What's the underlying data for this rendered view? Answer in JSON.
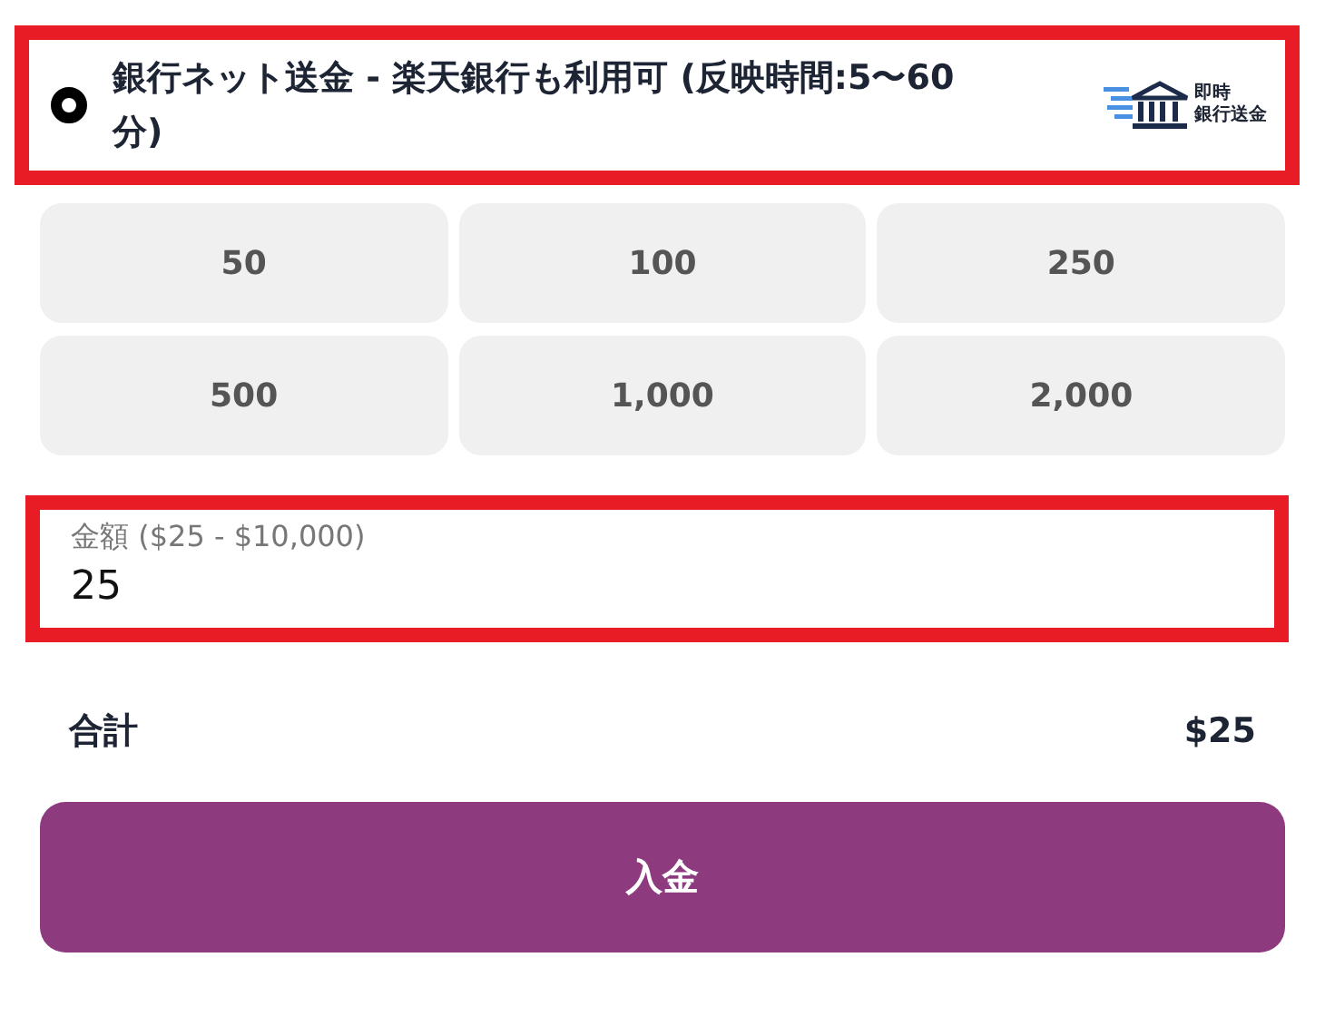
{
  "payment_option": {
    "label": "銀行ネット送金 - 楽天銀行も利用可 (反映時間:5〜60分)",
    "selected": true,
    "badge": {
      "line_1": "即時",
      "line_2": "銀行送金"
    }
  },
  "presets": [
    "50",
    "100",
    "250",
    "500",
    "1,000",
    "2,000"
  ],
  "amount_field": {
    "label": "金額 ($25 - $10,000)",
    "value": "25"
  },
  "total": {
    "label": "合計",
    "value": "$25"
  },
  "deposit_button": "入金"
}
